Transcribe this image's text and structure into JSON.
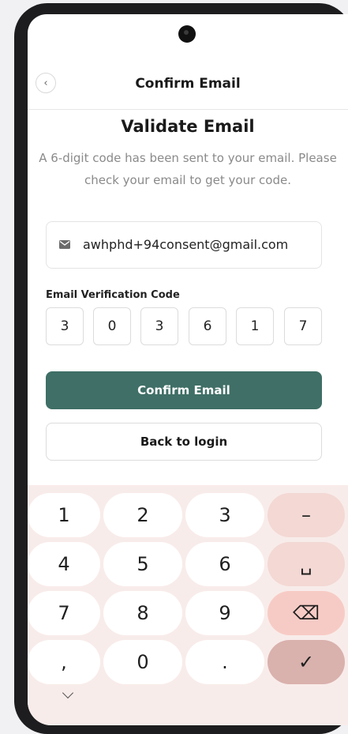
{
  "header": {
    "title": "Confirm Email",
    "back_icon": "chevron-left-icon"
  },
  "main": {
    "title": "Validate Email",
    "description": "A 6-digit code has been sent to your email. Please check your email to get your code.",
    "email": "awhphd+94consent@gmail.com",
    "email_icon": "mail-icon",
    "code_label": "Email Verification Code",
    "code_digits": [
      "3",
      "0",
      "3",
      "6",
      "1",
      "7"
    ],
    "confirm_button": "Confirm Email",
    "back_button": "Back to login"
  },
  "keyboard": {
    "keys": [
      "1",
      "2",
      "3",
      "–",
      "4",
      "5",
      "6",
      "␣",
      "7",
      "8",
      "9",
      "⌫",
      ",",
      "0",
      ".",
      "✓"
    ],
    "key_icons": [
      "minus-icon",
      "space-icon",
      "backspace-icon",
      "check-icon"
    ],
    "hide_icon": "chevron-down-icon"
  },
  "colors": {
    "primary": "#3f6f66",
    "keyboard_bg": "#f8ecea",
    "function_key": "#f3d8d4",
    "delete_key": "#f7cbc5",
    "enter_key": "#d9b1ad"
  }
}
